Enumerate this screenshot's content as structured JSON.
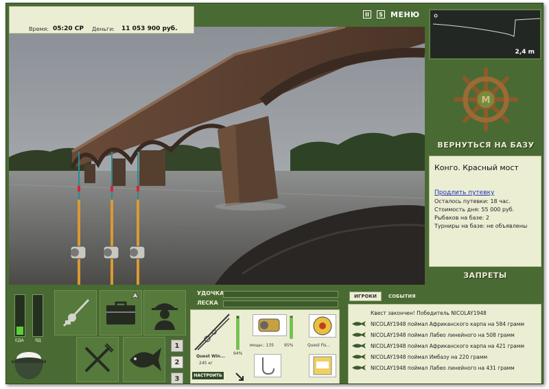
{
  "status": {
    "time_label": "Время:",
    "time_value": "05:20 СР",
    "money_label": "Деньги:",
    "money_value": "11 053 900 руб."
  },
  "toolbar": {
    "pause_label": "II",
    "s_label": "S",
    "menu_label": "МЕНЮ"
  },
  "depth": {
    "value": "2,4 m"
  },
  "return_label": "ВЕРНУТЬСЯ НА БАЗУ",
  "location": {
    "title": "Конго. Красный мост",
    "extend_link": "Продлить путевку",
    "lines": [
      "Осталось путевки: 18 час.",
      "Стоимость дня: 55 000 руб.",
      "Рыбаков на базе: 2",
      "Турниры на базе: не объявлены"
    ]
  },
  "bans_label": "ЗАПРЕТЫ",
  "meters": {
    "food_label": "ЕДА",
    "food_level": 0.2,
    "poison_label": "ЯД",
    "poison_level": 0.0
  },
  "pages": [
    "1",
    "2",
    "3"
  ],
  "bars": {
    "rod_label": "УДОЧКА",
    "line_label": "ЛЕСКА"
  },
  "equipment": {
    "rod_name": "Quest Win...",
    "rod_weight": "245 кг",
    "rod_durability": "94%",
    "reel_power": "мощн.: 135",
    "reel_durability": "95%",
    "line_name": "Quest Fis...",
    "setup_label": "НАСТРОИТЬ"
  },
  "events": {
    "tabs": [
      {
        "label": "ИГРОКИ",
        "active": true
      },
      {
        "label": "СОБЫТИЯ",
        "active": false
      }
    ],
    "lines": [
      "Квест закончен! Победитель NICOLAY1948",
      "NICOLAY1948 поймал Африканского карпа на 584 грамм",
      "NICOLAY1948 поймал Лабео линейного на 508 грамм",
      "NICOLAY1948 поймал Африканского карпа на 421 грамм",
      "NICOLAY1948 поймал Имбазу на 220 грамм",
      "NICOLAY1948 поймал Лабео линейного на 431 грамм"
    ]
  },
  "colors": {
    "frame_green": "#4a6a34",
    "panel_cream": "#eceed4",
    "meter_green": "#5ecf3a",
    "link_blue": "#1c2fb0"
  }
}
